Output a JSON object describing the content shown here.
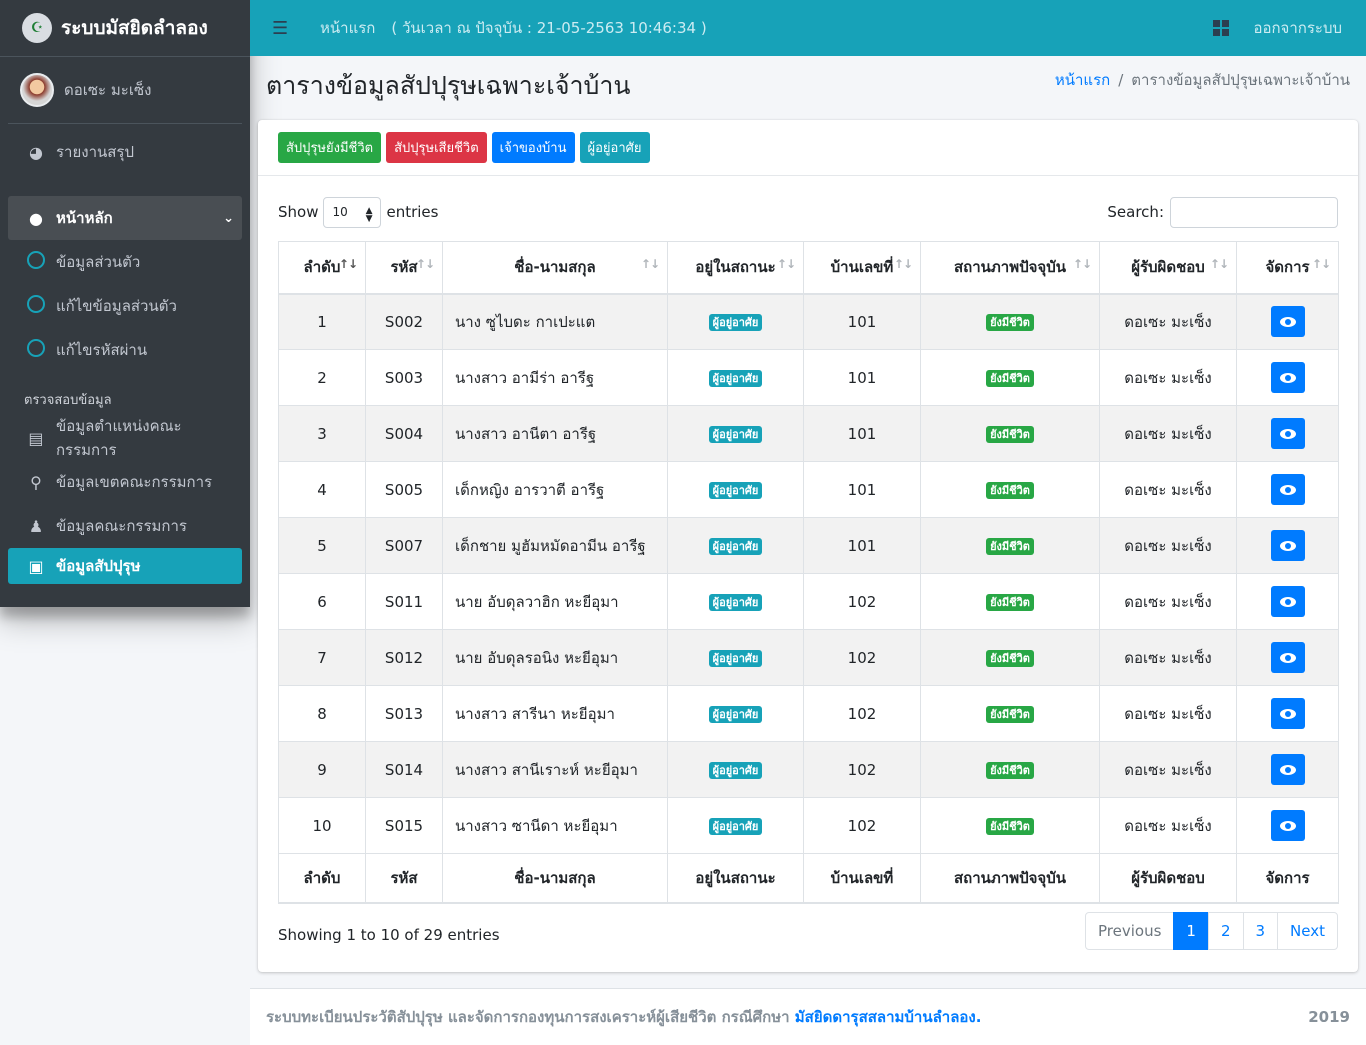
{
  "brand": {
    "title": "ระบบมัสยิดลำลอง"
  },
  "user": {
    "name": "ดอเซะ มะเซ็ง"
  },
  "sidebar": {
    "report": "รายงานสรุป",
    "main": "หน้าหลัก",
    "sub_items": [
      "ข้อมูลส่วนตัว",
      "แก้ไขข้อมูลส่วนตัว",
      "แก้ไขรหัสผ่าน"
    ],
    "section_header": "ตรวจสอบข้อมูล",
    "check_items": [
      "ข้อมูลตำแหน่งคณะกรรมการ",
      "ข้อมูลเขตคณะกรรมการ",
      "ข้อมูลคณะกรรมการ",
      "ข้อมูลสัปปุรุษ"
    ]
  },
  "topbar": {
    "home": "หน้าแรก",
    "clock": "( วันเวลา ณ ปัจจุบัน : 21-05-2563 10:46:34 )",
    "logout": "ออกจากระบบ"
  },
  "page": {
    "title": "ตารางข้อมูลสัปปุรุษเฉพาะเจ้าบ้าน",
    "breadcrumb_home": "หน้าแรก",
    "breadcrumb_current": "ตารางข้อมูลสัปปุรุษเฉพาะเจ้าบ้าน"
  },
  "filters": {
    "alive": "สัปปุรุษยังมีชีวิต",
    "dead": "สัปปุรุษเสียชีวิต",
    "owner": "เจ้าของบ้าน",
    "resident": "ผู้อยู่อาศัย"
  },
  "datatable": {
    "show_label": "Show",
    "page_size": "10",
    "entries_label": "entries",
    "search_label": "Search:",
    "search_value": "",
    "info": "Showing 1 to 10 of 29 entries",
    "prev": "Previous",
    "next": "Next",
    "pages": [
      "1",
      "2",
      "3"
    ]
  },
  "table": {
    "columns": [
      "ลำดับ",
      "รหัส",
      "ชื่อ-นามสกุล",
      "อยู่ในสถานะ",
      "บ้านเลขที่",
      "สถานภาพปัจจุบัน",
      "ผู้รับผิดชอบ",
      "จัดการ"
    ],
    "rows": [
      {
        "no": "1",
        "code": "S002",
        "name": "นาง ซูไบดะ กาเปะแต",
        "status": "ผู้อยู่อาศัย",
        "house": "101",
        "life": "ยังมีชีวิต",
        "owner": "ดอเซะ มะเซ็ง"
      },
      {
        "no": "2",
        "code": "S003",
        "name": "นางสาว อามีร่า อารีฐ",
        "status": "ผู้อยู่อาศัย",
        "house": "101",
        "life": "ยังมีชีวิต",
        "owner": "ดอเซะ มะเซ็ง"
      },
      {
        "no": "3",
        "code": "S004",
        "name": "นางสาว อานีตา อารีฐ",
        "status": "ผู้อยู่อาศัย",
        "house": "101",
        "life": "ยังมีชีวิต",
        "owner": "ดอเซะ มะเซ็ง"
      },
      {
        "no": "4",
        "code": "S005",
        "name": "เด็กหญิง อารวาตี อารีฐ",
        "status": "ผู้อยู่อาศัย",
        "house": "101",
        "life": "ยังมีชีวิต",
        "owner": "ดอเซะ มะเซ็ง"
      },
      {
        "no": "5",
        "code": "S007",
        "name": "เด็กชาย มูฮัมหมัดอามีน อารีฐ",
        "status": "ผู้อยู่อาศัย",
        "house": "101",
        "life": "ยังมีชีวิต",
        "owner": "ดอเซะ มะเซ็ง"
      },
      {
        "no": "6",
        "code": "S011",
        "name": "นาย อับดุลวาฮิก หะยีอุมา",
        "status": "ผู้อยู่อาศัย",
        "house": "102",
        "life": "ยังมีชีวิต",
        "owner": "ดอเซะ มะเซ็ง"
      },
      {
        "no": "7",
        "code": "S012",
        "name": "นาย อับดุลรอนิง หะยีอุมา",
        "status": "ผู้อยู่อาศัย",
        "house": "102",
        "life": "ยังมีชีวิต",
        "owner": "ดอเซะ มะเซ็ง"
      },
      {
        "no": "8",
        "code": "S013",
        "name": "นางสาว สารีนา หะยีอุมา",
        "status": "ผู้อยู่อาศัย",
        "house": "102",
        "life": "ยังมีชีวิต",
        "owner": "ดอเซะ มะเซ็ง"
      },
      {
        "no": "9",
        "code": "S014",
        "name": "นางสาว สานีเราะห์ หะยีอุมา",
        "status": "ผู้อยู่อาศัย",
        "house": "102",
        "life": "ยังมีชีวิต",
        "owner": "ดอเซะ มะเซ็ง"
      },
      {
        "no": "10",
        "code": "S015",
        "name": "นางสาว ซานีดา หะยีอุมา",
        "status": "ผู้อยู่อาศัย",
        "house": "102",
        "life": "ยังมีชีวิต",
        "owner": "ดอเซะ มะเซ็ง"
      }
    ]
  },
  "footer": {
    "text": "ระบบทะเบียนประวัติสัปปุรุษ และจัดการกองทุนการสงเคราะห์ผู้เสียชีวิต กรณีศึกษา",
    "link": "มัสยิดดารุสสลามบ้านลำลอง.",
    "year": "2019"
  },
  "colors": {
    "accent": "#17a2b8",
    "sidebar": "#343a40",
    "success": "#28a745",
    "danger": "#dc3545",
    "primary": "#007bff"
  },
  "icons": [
    "mosque-icon",
    "hamburger-icon",
    "grid-icon",
    "pie-chart-icon",
    "user-circle-icon",
    "chevron-down-icon",
    "circle-icon",
    "id-card-icon",
    "map-pin-icon",
    "user-icon",
    "address-book-icon",
    "eye-icon",
    "sort-icon"
  ]
}
